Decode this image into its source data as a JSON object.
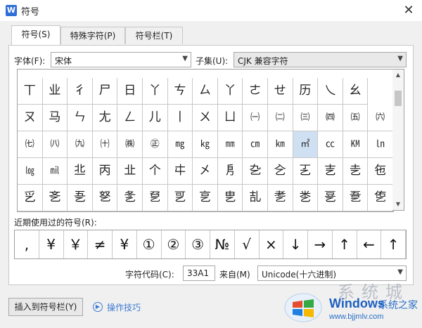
{
  "window": {
    "title": "符号",
    "app_icon": "W",
    "close_glyph": "✕"
  },
  "tabs": [
    {
      "label": "符号(S)",
      "active": true
    },
    {
      "label": "特殊字符(P)",
      "active": false
    },
    {
      "label": "符号栏(T)",
      "active": false
    }
  ],
  "font": {
    "label": "字体(F):",
    "value": "宋体"
  },
  "subset": {
    "label": "子集(U):",
    "value": "CJK 兼容字符"
  },
  "symbol_grid": {
    "rows": [
      [
        "丅",
        "业",
        "彳",
        "尸",
        "日",
        "丫",
        "ㄘ",
        "ㄙ",
        "丫",
        "ㄜ",
        "せ",
        "历",
        "乀",
        "幺"
      ],
      [
        "ㄡ",
        "马",
        "ㄣ",
        "尢",
        "ㄥ",
        "儿",
        "丨",
        "ㄨ",
        "ㄩ",
        "㈠",
        "㈡",
        "㈢",
        "㈣",
        "㈤",
        "㈥"
      ],
      [
        "㈦",
        "㈧",
        "㈨",
        "㈩",
        "㈱",
        "㊣",
        "㎎",
        "㎏",
        "㎜",
        "㎝",
        "㎞",
        "㎡",
        "㏄",
        "㏎",
        "㏑"
      ],
      [
        "㏒",
        "㏕",
        "丠",
        "丙",
        "㐀",
        "个",
        "㐄",
        "㐅",
        "㐆",
        "㐇",
        "㐈",
        "㐉",
        "㐊",
        "㐋",
        "㐌"
      ],
      [
        "㐍",
        "㐎",
        "㐏",
        "㐐",
        "㐑",
        "㐒",
        "㐓",
        "㐔",
        "㐕",
        "㐖",
        "㐗",
        "㐘",
        "㐙",
        "㐚",
        "㐛"
      ]
    ],
    "selected": "㎡"
  },
  "recent": {
    "label": "近期使用过的符号(R):",
    "symbols": [
      ",",
      "¥",
      "￥",
      "≠",
      "¥",
      "①",
      "②",
      "③",
      "№",
      "√",
      "×",
      "↓",
      "→",
      "↑",
      "←",
      "↑"
    ]
  },
  "code": {
    "label": "字符代码(C):",
    "value": "33A1",
    "from_label": "来自(M)",
    "from_value": "Unicode(十六进制)"
  },
  "buttons": {
    "insert": "插入到符号栏(Y)",
    "tips": "操作技巧"
  },
  "watermark": {
    "brand": "Windows",
    "brand2": "系统之家",
    "url": "www.bjjmlv.com",
    "faint": "系统城"
  }
}
